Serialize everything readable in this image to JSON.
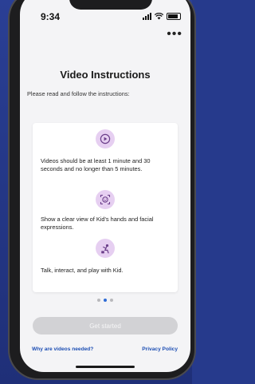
{
  "status_bar": {
    "time": "9:34"
  },
  "header": {
    "more_icon": "ellipsis-icon",
    "title": "Video Instructions",
    "subtitle": "Please read and follow the instructions:"
  },
  "instructions": [
    {
      "icon": "play-icon",
      "text": "Videos should be at least 1 minute and 30 seconds and no longer than 5 minutes."
    },
    {
      "icon": "face-scan-icon",
      "text": "Show a clear view of Kid's hands and facial expressions."
    },
    {
      "icon": "play-interact-icon",
      "text": "Talk, interact, and play with Kid."
    }
  ],
  "pager": {
    "total": 3,
    "active_index": 1
  },
  "actions": {
    "get_started_label": "Get started",
    "why_link": "Why are videos needed?",
    "privacy_link": "Privacy Policy"
  },
  "colors": {
    "accent": "#1e4fb4",
    "icon_bg": "#e6cff1",
    "icon_fg": "#6b3f8a",
    "disabled_button": "#d2d2d5",
    "background": "#263a8c"
  }
}
